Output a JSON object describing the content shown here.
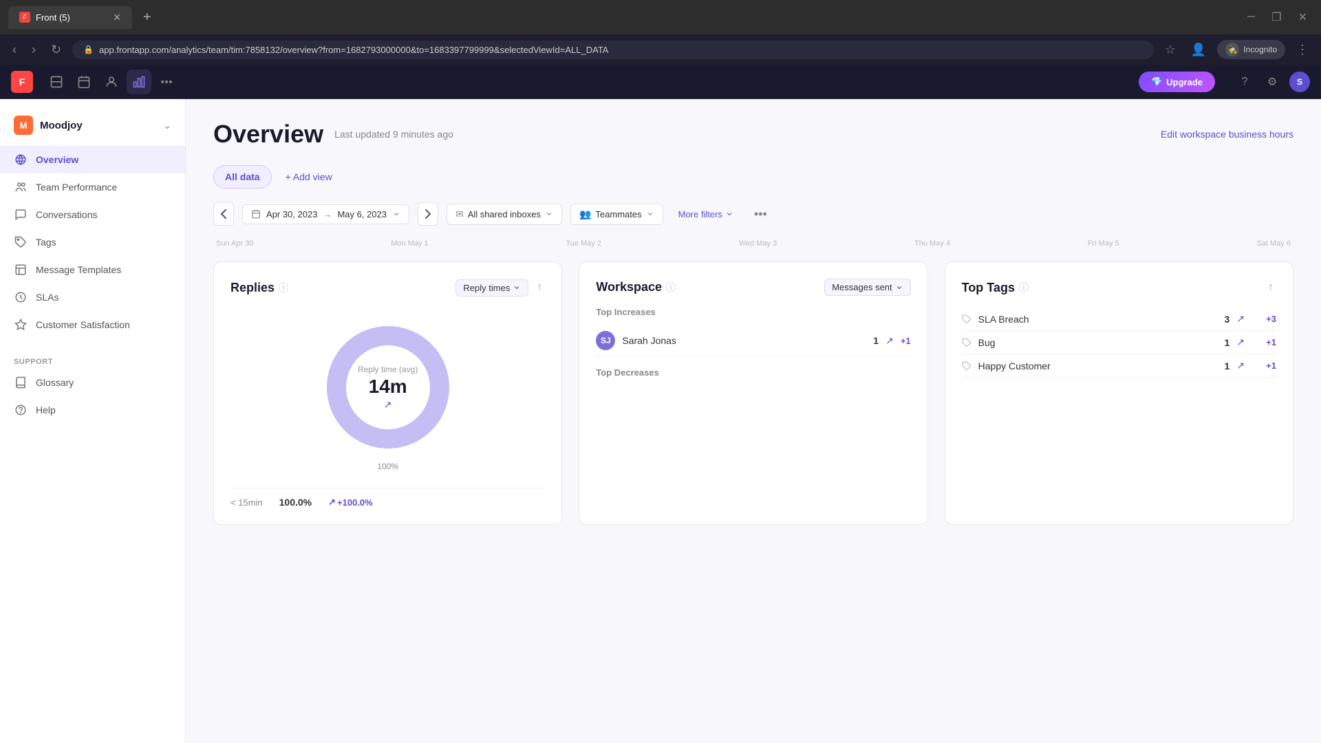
{
  "browser": {
    "tab_title": "Front (5)",
    "url": "app.frontapp.com/analytics/team/tim:7858132/overview?from=1682793000000&to=1683397799999&selectedViewId=ALL_DATA",
    "new_tab_label": "+",
    "incognito_label": "Incognito"
  },
  "topbar": {
    "upgrade_label": "Upgrade",
    "help_icon": "?",
    "avatar_initials": "S"
  },
  "sidebar": {
    "workspace_name": "Moodjoy",
    "nav_items": [
      {
        "label": "Overview",
        "active": true,
        "icon": "globe"
      },
      {
        "label": "Team Performance",
        "active": false,
        "icon": "users"
      },
      {
        "label": "Conversations",
        "active": false,
        "icon": "chat"
      },
      {
        "label": "Tags",
        "active": false,
        "icon": "tag"
      },
      {
        "label": "Message Templates",
        "active": false,
        "icon": "template"
      },
      {
        "label": "SLAs",
        "active": false,
        "icon": "clock"
      },
      {
        "label": "Customer Satisfaction",
        "active": false,
        "icon": "star"
      }
    ],
    "support_section_label": "Support",
    "support_items": [
      {
        "label": "Glossary",
        "icon": "book"
      },
      {
        "label": "Help",
        "icon": "help"
      }
    ]
  },
  "page": {
    "title": "Overview",
    "last_updated": "Last updated 9 minutes ago",
    "edit_business_hours": "Edit workspace business hours"
  },
  "tabs": [
    {
      "label": "All data",
      "active": true
    },
    {
      "label": "+ Add view",
      "active": false
    }
  ],
  "filters": {
    "date_from": "Apr 30, 2023",
    "date_to": "May 6, 2023",
    "inbox": "All shared inboxes",
    "teammates": "Teammates",
    "more_filters": "More filters",
    "nav_prev": "‹",
    "nav_next": "›"
  },
  "chart_dates": [
    "Sun Apr 30",
    "Mon May 1",
    "Tue May 2",
    "Wed May 3",
    "Thu May 4",
    "Fri May 5",
    "Sat May 6"
  ],
  "replies_card": {
    "title": "Replies",
    "dropdown": "Reply times",
    "donut_label": "Reply time (avg)",
    "donut_value": "14m",
    "donut_trend": "↗",
    "donut_pct": "100%",
    "footer_label": "< 15min",
    "footer_value": "100.0%",
    "footer_delta": "+100.0%",
    "footer_delta_icon": "↗"
  },
  "workspace_card": {
    "title": "Workspace",
    "dropdown": "Messages sent",
    "top_increases_label": "Top Increases",
    "users": [
      {
        "name": "Sarah Jonas",
        "initials": "SJ",
        "color": "#7c6fd8",
        "count": "1",
        "delta": "+1"
      }
    ],
    "top_decreases_label": "Top Decreases",
    "decreases": []
  },
  "top_tags_card": {
    "title": "Top Tags",
    "tags": [
      {
        "name": "SLA Breach",
        "count": "3",
        "delta": "+3"
      },
      {
        "name": "Bug",
        "count": "1",
        "delta": "+1"
      },
      {
        "name": "Happy Customer",
        "count": "1",
        "delta": "+1"
      }
    ]
  }
}
